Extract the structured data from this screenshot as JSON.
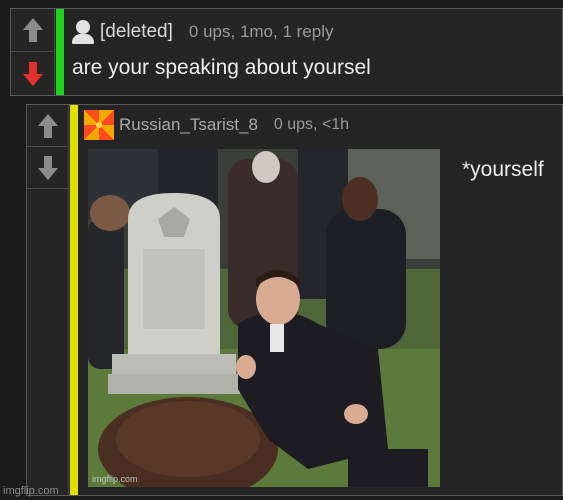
{
  "comments": [
    {
      "username": "[deleted]",
      "meta": "0 ups, 1mo, 1 reply",
      "text": "are your speaking about yoursel",
      "bar_color": "#21d51f",
      "avatar_icon": "user-silhouette-icon",
      "downvoted": true
    },
    {
      "username": "Russian_Tsarist_8",
      "meta": "0 ups, <1h",
      "text": "*yourself",
      "bar_color": "#e3e000",
      "avatar_icon": "pinwheel-avatar-icon",
      "meme_watermark": "imgflip.com"
    }
  ],
  "site_watermark": "imgflip.com",
  "colors": {
    "upvote": "#8c8c8c",
    "downvote_active": "#e5312c"
  }
}
